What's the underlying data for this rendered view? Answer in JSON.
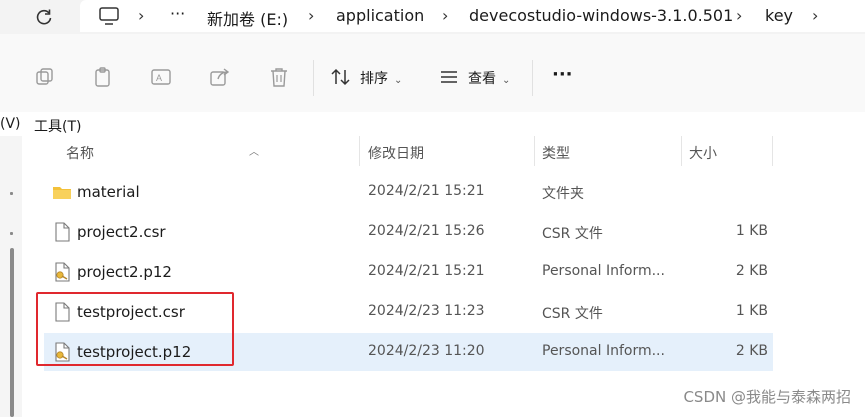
{
  "breadcrumb": {
    "more": "···",
    "items": [
      "新加卷 (E:)",
      "application",
      "devecostudio-windows-3.1.0.501",
      "key"
    ]
  },
  "toolbar": {
    "sort_label": "排序",
    "view_label": "查看",
    "more_label": "···"
  },
  "menubar": {
    "view_partial": "(V)",
    "tools": "工具(T)"
  },
  "columns": {
    "name": "名称",
    "date": "修改日期",
    "type": "类型",
    "size": "大小"
  },
  "files": [
    {
      "name": "material",
      "date": "2024/2/21 15:21",
      "type": "文件夹",
      "size": "",
      "icon": "folder-icon"
    },
    {
      "name": "project2.csr",
      "date": "2024/2/21 15:26",
      "type": "CSR 文件",
      "size": "1 KB",
      "icon": "file-icon"
    },
    {
      "name": "project2.p12",
      "date": "2024/2/21 15:21",
      "type": "Personal Inform...",
      "size": "2 KB",
      "icon": "certificate-icon"
    },
    {
      "name": "testproject.csr",
      "date": "2024/2/23 11:23",
      "type": "CSR 文件",
      "size": "1 KB",
      "icon": "file-icon"
    },
    {
      "name": "testproject.p12",
      "date": "2024/2/23 11:20",
      "type": "Personal Inform...",
      "size": "2 KB",
      "icon": "certificate-icon"
    }
  ],
  "watermark": "CSDN @我能与泰森两招",
  "colors": {
    "selection": "#e5f0fb",
    "highlight": "#e0282e",
    "folder": "#f3c13a"
  }
}
